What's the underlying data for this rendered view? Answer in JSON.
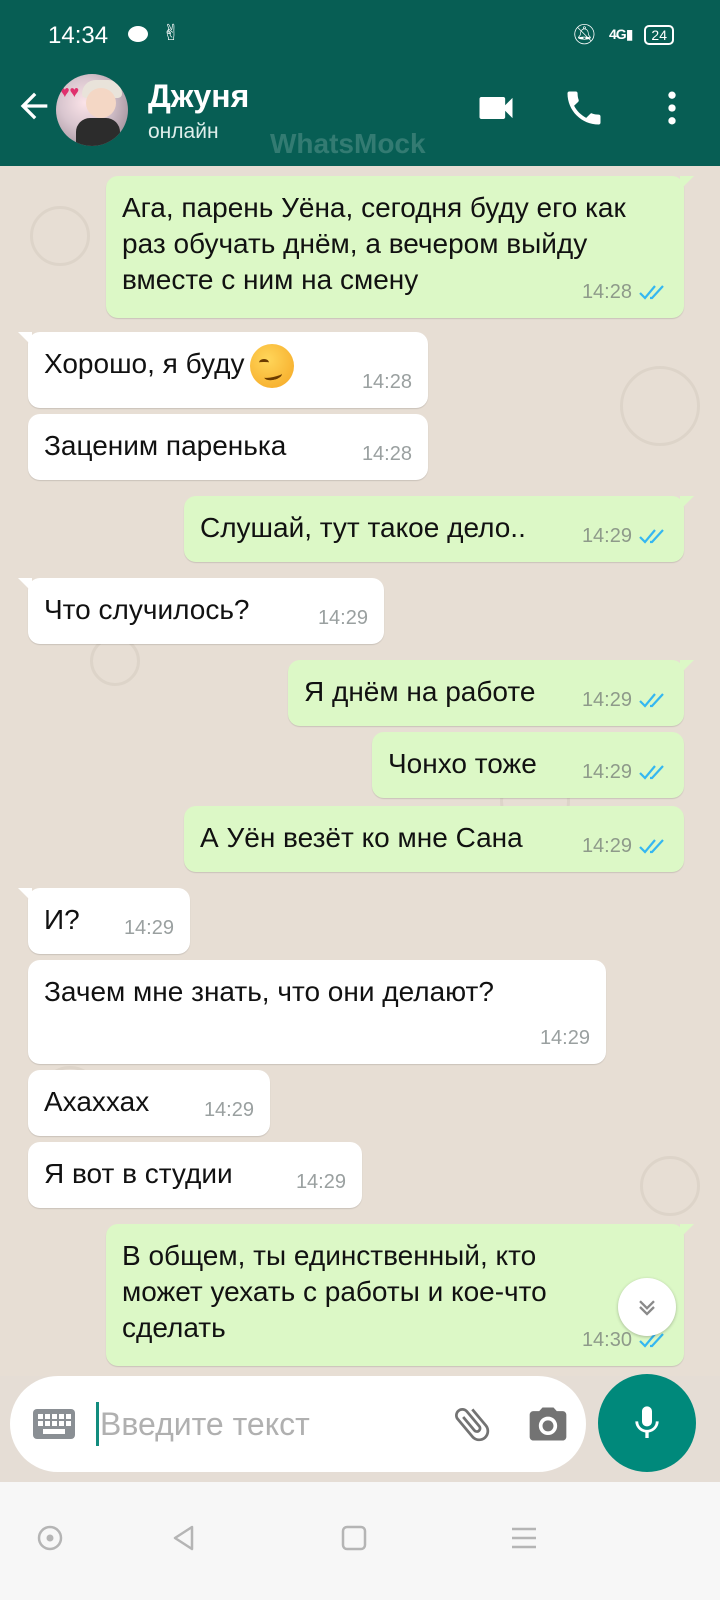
{
  "status_bar": {
    "time": "14:34",
    "network": "4G",
    "battery": "24"
  },
  "header": {
    "contact_name": "Джуня",
    "contact_status": "онлайн",
    "watermark": "WhatsMock"
  },
  "messages": [
    {
      "dir": "out",
      "text": "Ага, парень Уёна, сегодня буду его как раз обучать днём, а вечером выйду вместе с ним на смену",
      "time": "14:28",
      "read": true
    },
    {
      "dir": "in",
      "text": "Хорошо, я буду",
      "emoji": "smirk",
      "time": "14:28"
    },
    {
      "dir": "in",
      "text": "Заценим паренька",
      "time": "14:28"
    },
    {
      "dir": "out",
      "text": "Слушай, тут такое дело..",
      "time": "14:29",
      "read": true
    },
    {
      "dir": "in",
      "text": "Что случилось?",
      "time": "14:29"
    },
    {
      "dir": "out",
      "text": "Я днём на работе",
      "time": "14:29",
      "read": true
    },
    {
      "dir": "out",
      "text": "Чонхо тоже",
      "time": "14:29",
      "read": true
    },
    {
      "dir": "out",
      "text": "А Уён везёт ко мне Сана",
      "time": "14:29",
      "read": true
    },
    {
      "dir": "in",
      "text": "И?",
      "time": "14:29"
    },
    {
      "dir": "in",
      "text": "Зачем мне знать, что они делают?",
      "time": "14:29"
    },
    {
      "dir": "in",
      "text": "Ахаххах",
      "time": "14:29"
    },
    {
      "dir": "in",
      "text": "Я вот в студии",
      "time": "14:29"
    },
    {
      "dir": "out",
      "text": "В общем, ты единственный, кто может уехать с работы и кое-что сделать",
      "time": "14:30",
      "read": true
    }
  ],
  "input": {
    "placeholder": "Введите текст",
    "value": ""
  },
  "colors": {
    "header": "#075e54",
    "outgoing_bubble": "#dcf8c6",
    "incoming_bubble": "#ffffff",
    "read_ticks": "#34b7f1",
    "mic_button": "#00897b"
  },
  "icons": [
    "back-arrow-icon",
    "video-call-icon",
    "phone-icon",
    "more-vert-icon",
    "keyboard-icon",
    "attach-icon",
    "camera-icon",
    "mic-icon",
    "chevron-down-icon"
  ]
}
